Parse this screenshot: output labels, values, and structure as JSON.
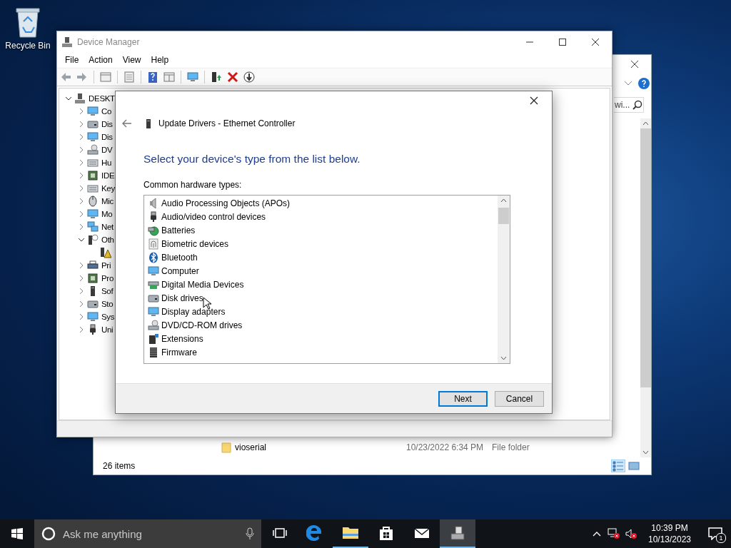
{
  "desktop": {
    "icons": [
      {
        "label": "Recycle Bin"
      }
    ]
  },
  "explorer": {
    "search": {
      "value": "wi..."
    },
    "rows": [
      {
        "name": "vioserial",
        "date_modified": "10/23/2022 6:34 PM",
        "type": "File folder"
      }
    ],
    "status_bar": {
      "item_count": "26 items"
    },
    "view_buttons": [
      {
        "selected": true
      },
      {
        "selected": false
      }
    ]
  },
  "device_manager": {
    "title": "Device Manager",
    "menu": [
      "File",
      "Action",
      "View",
      "Help"
    ],
    "tree": {
      "label": "DESKT",
      "expanded": true,
      "children": [
        {
          "label": "Co",
          "expanded": false
        },
        {
          "label": "Dis",
          "expanded": false
        },
        {
          "label": "Dis",
          "expanded": false
        },
        {
          "label": "DV",
          "expanded": false
        },
        {
          "label": "Hu",
          "expanded": false
        },
        {
          "label": "IDE",
          "expanded": false
        },
        {
          "label": "Key",
          "expanded": false
        },
        {
          "label": "Mic",
          "expanded": false
        },
        {
          "label": "Mo",
          "expanded": false
        },
        {
          "label": "Net",
          "expanded": false
        },
        {
          "label": "Oth",
          "expanded": true,
          "children": [
            {
              "kind": "warning-device"
            }
          ]
        },
        {
          "label": "Pri",
          "expanded": false
        },
        {
          "label": "Pro",
          "expanded": false
        },
        {
          "label": "Sof",
          "expanded": false
        },
        {
          "label": "Sto",
          "expanded": false
        },
        {
          "label": "Sys",
          "expanded": false
        },
        {
          "label": "Uni",
          "expanded": false
        }
      ]
    }
  },
  "dialog": {
    "title": "Update Drivers - Ethernet Controller",
    "heading": "Select your device's type from the list below.",
    "list_label": "Common hardware types:",
    "hardware_types": [
      "Audio Processing Objects (APOs)",
      "Audio/video control devices",
      "Batteries",
      "Biometric devices",
      "Bluetooth",
      "Computer",
      "Digital Media Devices",
      "Disk drives",
      "Display adapters",
      "DVD/CD-ROM drives",
      "Extensions",
      "Firmware"
    ],
    "buttons": [
      {
        "label": "Next",
        "default": true
      },
      {
        "label": "Cancel",
        "default": false
      }
    ]
  },
  "taskbar": {
    "search": {
      "placeholder": "Ask me anything"
    },
    "apps": [
      {
        "kind": "browser",
        "running": false,
        "selected": false
      },
      {
        "kind": "files",
        "running": true,
        "selected": false
      },
      {
        "kind": "store",
        "running": false,
        "selected": false
      },
      {
        "kind": "mail",
        "running": false,
        "selected": false
      },
      {
        "kind": "device-manager",
        "running": true,
        "selected": true
      }
    ],
    "clock": {
      "time": "10:39 PM",
      "date": "10/13/2023"
    },
    "notifications": {
      "count": "1"
    }
  }
}
